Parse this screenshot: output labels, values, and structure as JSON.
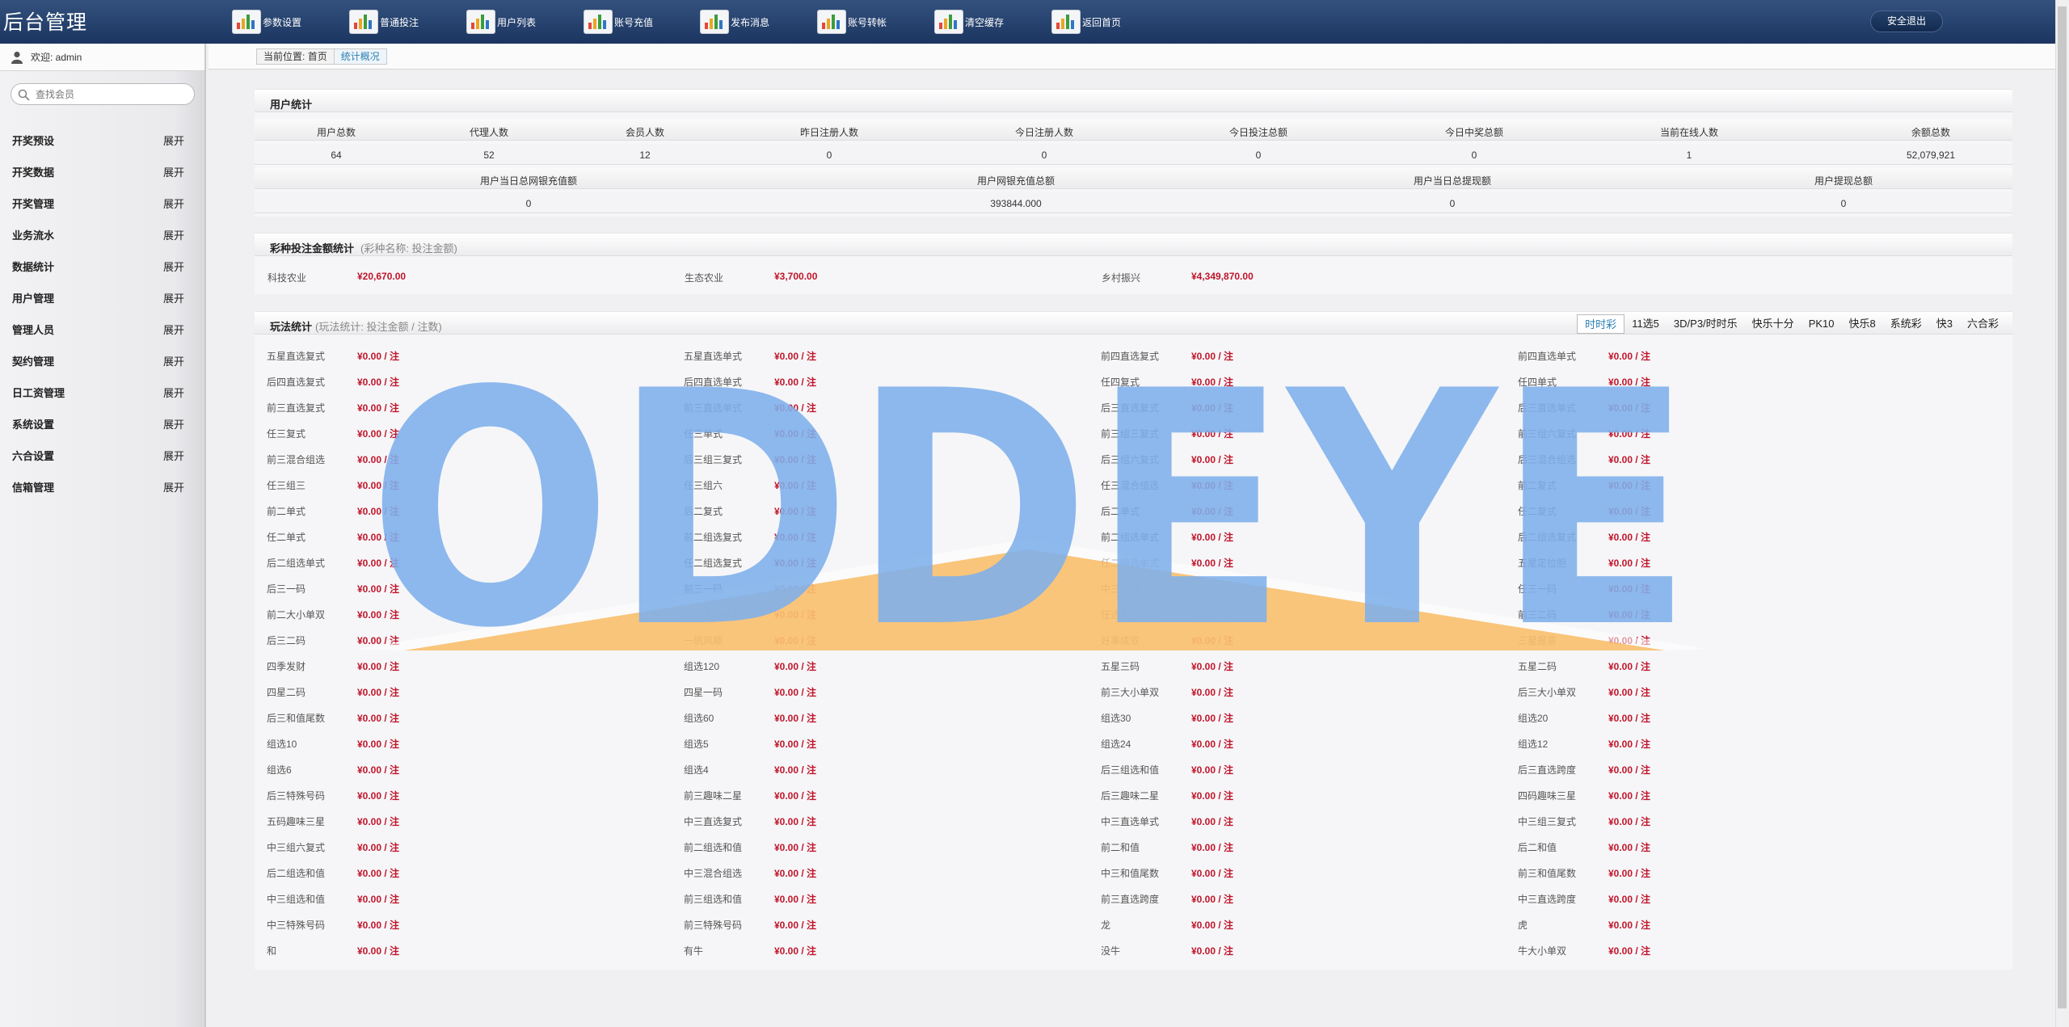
{
  "app": {
    "title": "后台管理",
    "logout": "安全退出"
  },
  "topnav": [
    {
      "label": "参数设置"
    },
    {
      "label": "普通投注"
    },
    {
      "label": "用户列表"
    },
    {
      "label": "账号充值"
    },
    {
      "label": "发布消息"
    },
    {
      "label": "账号转帐"
    },
    {
      "label": "清空缓存"
    },
    {
      "label": "返回首页"
    }
  ],
  "sidebar": {
    "welcome": "欢迎: admin",
    "search_placeholder": "查找会员",
    "items": [
      {
        "label": "开奖预设",
        "action": "展开"
      },
      {
        "label": "开奖数据",
        "action": "展开"
      },
      {
        "label": "开奖管理",
        "action": "展开"
      },
      {
        "label": "业务流水",
        "action": "展开"
      },
      {
        "label": "数据统计",
        "action": "展开"
      },
      {
        "label": "用户管理",
        "action": "展开"
      },
      {
        "label": "管理人员",
        "action": "展开"
      },
      {
        "label": "契约管理",
        "action": "展开"
      },
      {
        "label": "日工资管理",
        "action": "展开"
      },
      {
        "label": "系统设置",
        "action": "展开"
      },
      {
        "label": "六合设置",
        "action": "展开"
      },
      {
        "label": "信箱管理",
        "action": "展开"
      }
    ]
  },
  "breadcrumb": {
    "prefix": "当前位置:",
    "home": "首页",
    "current": "统计概况"
  },
  "user_stats": {
    "title": "用户统计",
    "headers1": [
      "用户总数",
      "代理人数",
      "会员人数",
      "昨日注册人数",
      "今日注册人数",
      "今日投注总额",
      "今日中奖总额",
      "当前在线人数",
      "余额总数"
    ],
    "values1": [
      "64",
      "52",
      "12",
      "0",
      "0",
      "0",
      "0",
      "1",
      "52,079,921"
    ],
    "headers2": [
      "用户当日总网银充值额",
      "用户网银充值总额",
      "用户当日总提现额",
      "用户提现总额"
    ],
    "values2": [
      "0",
      "393844.000",
      "0",
      "0"
    ]
  },
  "lottery_stats": {
    "title": "彩种投注金额统计",
    "subtitle": "(彩种名称: 投注金额)",
    "items": [
      {
        "name": "科技农业",
        "value": "¥20,670.00"
      },
      {
        "name": "生态农业",
        "value": "¥3,700.00"
      },
      {
        "name": "乡村振兴",
        "value": "¥4,349,870.00"
      }
    ]
  },
  "play_stats": {
    "title": "玩法统计",
    "subtitle": "(玩法统计: 投注金额 / 注数)",
    "tabs": [
      "时时彩",
      "11选5",
      "3D/P3/时时乐",
      "快乐十分",
      "PK10",
      "快乐8",
      "系统彩",
      "快3",
      "六合彩"
    ],
    "value": "¥0.00 / 注",
    "rows": [
      [
        "五星直选复式",
        "五星直选单式",
        "前四直选复式",
        "前四直选单式"
      ],
      [
        "后四直选复式",
        "后四直选单式",
        "任四复式",
        "任四单式"
      ],
      [
        "前三直选复式",
        "前三直选单式",
        "后三直选复式",
        "后三直选单式"
      ],
      [
        "任三复式",
        "任三单式",
        "前三组三复式",
        "前三组六复式"
      ],
      [
        "前三混合组选",
        "后三组三复式",
        "后三组六复式",
        "后三混合组选"
      ],
      [
        "任三组三",
        "任三组六",
        "任三混合组选",
        "前二复式"
      ],
      [
        "前二单式",
        "后二复式",
        "后二单式",
        "任二复式"
      ],
      [
        "任二单式",
        "前二组选复式",
        "前二组选单式",
        "后二组选复式"
      ],
      [
        "后二组选单式",
        "任二组选复式",
        "任二组选单式",
        "五星定位胆"
      ],
      [
        "后三一码",
        "前三一码",
        "中三一码",
        "任三一码"
      ],
      [
        "前二大小单双",
        "后二大小单双",
        "任选大小单双",
        "前三二码"
      ],
      [
        "后三二码",
        "一帆风顺",
        "好事成双",
        "三星报喜"
      ],
      [
        "四季发财",
        "组选120",
        "五星三码",
        "五星二码"
      ],
      [
        "四星二码",
        "四星一码",
        "前三大小单双",
        "后三大小单双"
      ],
      [
        "后三和值尾数",
        "组选60",
        "组选30",
        "组选20"
      ],
      [
        "组选10",
        "组选5",
        "组选24",
        "组选12"
      ],
      [
        "组选6",
        "组选4",
        "后三组选和值",
        "后三直选跨度"
      ],
      [
        "后三特殊号码",
        "前三趣味二星",
        "后三趣味二星",
        "四码趣味三星"
      ],
      [
        "五码趣味三星",
        "中三直选复式",
        "中三直选单式",
        "中三组三复式"
      ],
      [
        "中三组六复式",
        "前二组选和值",
        "前二和值",
        "后二和值"
      ],
      [
        "后二组选和值",
        "中三混合组选",
        "中三和值尾数",
        "前三和值尾数"
      ],
      [
        "中三组选和值",
        "前三组选和值",
        "前三直选跨度",
        "中三直选跨度"
      ],
      [
        "中三特殊号码",
        "前三特殊号码",
        "龙",
        "虎"
      ],
      [
        "和",
        "有牛",
        "没牛",
        "牛大小单双"
      ]
    ]
  },
  "watermark": {
    "text": "ODDEYE"
  },
  "colors": {
    "topbar": "#1f3a66",
    "accent": "#2a7fb3",
    "money": "#c0152a",
    "watermark_blue": "#7fb0ec",
    "watermark_orange": "#f9c06f"
  },
  "icons": {
    "topnav": "chart-icon",
    "user": "user-icon",
    "search": "search-icon"
  }
}
